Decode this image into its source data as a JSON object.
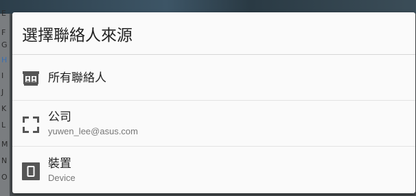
{
  "background": {
    "index_letters": [
      "E",
      "F",
      "G",
      "H",
      "I",
      "J",
      "K",
      "L",
      "M",
      "N",
      "O"
    ]
  },
  "dialog": {
    "title": "選擇聯絡人來源",
    "options": [
      {
        "label": "所有聯絡人",
        "sublabel": "",
        "icon": "all-contacts-icon"
      },
      {
        "label": "公司",
        "sublabel": "yuwen_lee@asus.com",
        "icon": "exchange-account-icon"
      },
      {
        "label": "裝置",
        "sublabel": "Device",
        "icon": "device-icon"
      }
    ]
  },
  "colors": {
    "dialog_bg": "#fafafa",
    "title_text": "#222222",
    "sub_text": "#777777",
    "icon_gray": "#555555",
    "divider": "#e2e2e2"
  }
}
